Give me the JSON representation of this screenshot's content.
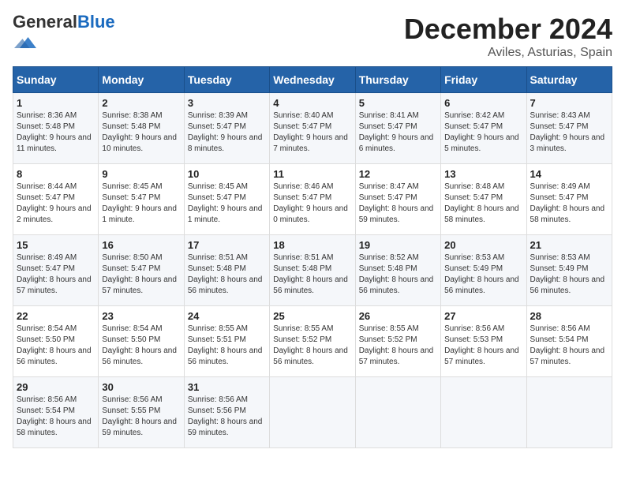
{
  "header": {
    "logo_general": "General",
    "logo_blue": "Blue",
    "month_title": "December 2024",
    "location": "Aviles, Asturias, Spain"
  },
  "days_of_week": [
    "Sunday",
    "Monday",
    "Tuesday",
    "Wednesday",
    "Thursday",
    "Friday",
    "Saturday"
  ],
  "weeks": [
    [
      {
        "day": "1",
        "sunrise": "Sunrise: 8:36 AM",
        "sunset": "Sunset: 5:48 PM",
        "daylight": "Daylight: 9 hours and 11 minutes."
      },
      {
        "day": "2",
        "sunrise": "Sunrise: 8:38 AM",
        "sunset": "Sunset: 5:48 PM",
        "daylight": "Daylight: 9 hours and 10 minutes."
      },
      {
        "day": "3",
        "sunrise": "Sunrise: 8:39 AM",
        "sunset": "Sunset: 5:47 PM",
        "daylight": "Daylight: 9 hours and 8 minutes."
      },
      {
        "day": "4",
        "sunrise": "Sunrise: 8:40 AM",
        "sunset": "Sunset: 5:47 PM",
        "daylight": "Daylight: 9 hours and 7 minutes."
      },
      {
        "day": "5",
        "sunrise": "Sunrise: 8:41 AM",
        "sunset": "Sunset: 5:47 PM",
        "daylight": "Daylight: 9 hours and 6 minutes."
      },
      {
        "day": "6",
        "sunrise": "Sunrise: 8:42 AM",
        "sunset": "Sunset: 5:47 PM",
        "daylight": "Daylight: 9 hours and 5 minutes."
      },
      {
        "day": "7",
        "sunrise": "Sunrise: 8:43 AM",
        "sunset": "Sunset: 5:47 PM",
        "daylight": "Daylight: 9 hours and 3 minutes."
      }
    ],
    [
      {
        "day": "8",
        "sunrise": "Sunrise: 8:44 AM",
        "sunset": "Sunset: 5:47 PM",
        "daylight": "Daylight: 9 hours and 2 minutes."
      },
      {
        "day": "9",
        "sunrise": "Sunrise: 8:45 AM",
        "sunset": "Sunset: 5:47 PM",
        "daylight": "Daylight: 9 hours and 1 minute."
      },
      {
        "day": "10",
        "sunrise": "Sunrise: 8:45 AM",
        "sunset": "Sunset: 5:47 PM",
        "daylight": "Daylight: 9 hours and 1 minute."
      },
      {
        "day": "11",
        "sunrise": "Sunrise: 8:46 AM",
        "sunset": "Sunset: 5:47 PM",
        "daylight": "Daylight: 9 hours and 0 minutes."
      },
      {
        "day": "12",
        "sunrise": "Sunrise: 8:47 AM",
        "sunset": "Sunset: 5:47 PM",
        "daylight": "Daylight: 8 hours and 59 minutes."
      },
      {
        "day": "13",
        "sunrise": "Sunrise: 8:48 AM",
        "sunset": "Sunset: 5:47 PM",
        "daylight": "Daylight: 8 hours and 58 minutes."
      },
      {
        "day": "14",
        "sunrise": "Sunrise: 8:49 AM",
        "sunset": "Sunset: 5:47 PM",
        "daylight": "Daylight: 8 hours and 58 minutes."
      }
    ],
    [
      {
        "day": "15",
        "sunrise": "Sunrise: 8:49 AM",
        "sunset": "Sunset: 5:47 PM",
        "daylight": "Daylight: 8 hours and 57 minutes."
      },
      {
        "day": "16",
        "sunrise": "Sunrise: 8:50 AM",
        "sunset": "Sunset: 5:47 PM",
        "daylight": "Daylight: 8 hours and 57 minutes."
      },
      {
        "day": "17",
        "sunrise": "Sunrise: 8:51 AM",
        "sunset": "Sunset: 5:48 PM",
        "daylight": "Daylight: 8 hours and 56 minutes."
      },
      {
        "day": "18",
        "sunrise": "Sunrise: 8:51 AM",
        "sunset": "Sunset: 5:48 PM",
        "daylight": "Daylight: 8 hours and 56 minutes."
      },
      {
        "day": "19",
        "sunrise": "Sunrise: 8:52 AM",
        "sunset": "Sunset: 5:48 PM",
        "daylight": "Daylight: 8 hours and 56 minutes."
      },
      {
        "day": "20",
        "sunrise": "Sunrise: 8:53 AM",
        "sunset": "Sunset: 5:49 PM",
        "daylight": "Daylight: 8 hours and 56 minutes."
      },
      {
        "day": "21",
        "sunrise": "Sunrise: 8:53 AM",
        "sunset": "Sunset: 5:49 PM",
        "daylight": "Daylight: 8 hours and 56 minutes."
      }
    ],
    [
      {
        "day": "22",
        "sunrise": "Sunrise: 8:54 AM",
        "sunset": "Sunset: 5:50 PM",
        "daylight": "Daylight: 8 hours and 56 minutes."
      },
      {
        "day": "23",
        "sunrise": "Sunrise: 8:54 AM",
        "sunset": "Sunset: 5:50 PM",
        "daylight": "Daylight: 8 hours and 56 minutes."
      },
      {
        "day": "24",
        "sunrise": "Sunrise: 8:55 AM",
        "sunset": "Sunset: 5:51 PM",
        "daylight": "Daylight: 8 hours and 56 minutes."
      },
      {
        "day": "25",
        "sunrise": "Sunrise: 8:55 AM",
        "sunset": "Sunset: 5:52 PM",
        "daylight": "Daylight: 8 hours and 56 minutes."
      },
      {
        "day": "26",
        "sunrise": "Sunrise: 8:55 AM",
        "sunset": "Sunset: 5:52 PM",
        "daylight": "Daylight: 8 hours and 57 minutes."
      },
      {
        "day": "27",
        "sunrise": "Sunrise: 8:56 AM",
        "sunset": "Sunset: 5:53 PM",
        "daylight": "Daylight: 8 hours and 57 minutes."
      },
      {
        "day": "28",
        "sunrise": "Sunrise: 8:56 AM",
        "sunset": "Sunset: 5:54 PM",
        "daylight": "Daylight: 8 hours and 57 minutes."
      }
    ],
    [
      {
        "day": "29",
        "sunrise": "Sunrise: 8:56 AM",
        "sunset": "Sunset: 5:54 PM",
        "daylight": "Daylight: 8 hours and 58 minutes."
      },
      {
        "day": "30",
        "sunrise": "Sunrise: 8:56 AM",
        "sunset": "Sunset: 5:55 PM",
        "daylight": "Daylight: 8 hours and 59 minutes."
      },
      {
        "day": "31",
        "sunrise": "Sunrise: 8:56 AM",
        "sunset": "Sunset: 5:56 PM",
        "daylight": "Daylight: 8 hours and 59 minutes."
      },
      null,
      null,
      null,
      null
    ]
  ]
}
